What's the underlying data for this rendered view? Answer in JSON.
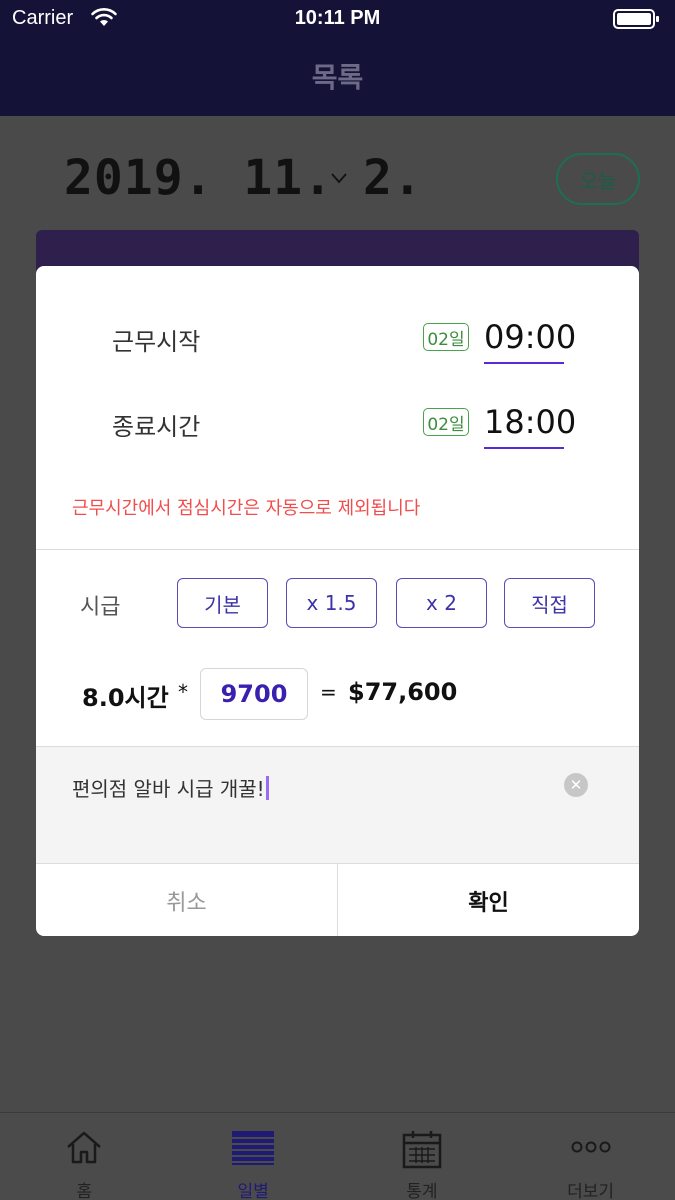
{
  "status_bar": {
    "carrier": "Carrier",
    "time": "10:11 PM"
  },
  "nav": {
    "title": "목록"
  },
  "background": {
    "date": "2019. 11. 2.",
    "today_button": "오늘"
  },
  "modal": {
    "start": {
      "label": "근무시작",
      "day": "02일",
      "time": "09:00"
    },
    "end": {
      "label": "종료시간",
      "day": "02일",
      "time": "18:00"
    },
    "notice": "근무시간에서 점심시간은 자동으로 제외됩니다",
    "wage": {
      "label": "시급",
      "options": [
        "기본",
        "x 1.5",
        "x 2",
        "직접"
      ],
      "hours": "8.0시간",
      "multiply": "*",
      "hourly_rate": "9700",
      "equals": "=",
      "total": "$77,600"
    },
    "memo": {
      "text": "편의점 알바 시급 개꿀!"
    },
    "buttons": {
      "cancel": "취소",
      "confirm": "확인"
    }
  },
  "tabs": [
    {
      "label": "홈",
      "icon": "home-icon"
    },
    {
      "label": "일별",
      "icon": "list-icon",
      "active": true
    },
    {
      "label": "통계",
      "icon": "calendar-icon"
    },
    {
      "label": "더보기",
      "icon": "more-icon"
    }
  ],
  "colors": {
    "nav_bg": "#141236",
    "accent_purple": "#5a2bd0",
    "warning_red": "#f04d4d",
    "badge_green": "#4aa34a"
  }
}
